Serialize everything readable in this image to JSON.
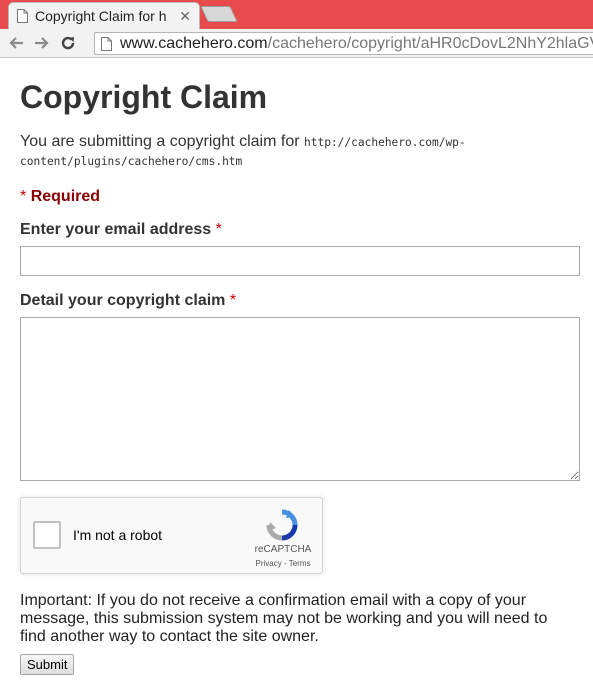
{
  "browser": {
    "tab_title": "Copyright Claim for h",
    "tab_close": "✕",
    "url_host": "www.cachehero.com",
    "url_path": "/cachehero/copyright/aHR0cDovL2NhY2hlaGV"
  },
  "page": {
    "title": "Copyright Claim",
    "intro_text": "You are submitting a copyright claim for ",
    "claim_url": "http://cachehero.com/wp-content/plugins/cachehero/cms.htm",
    "required_star": "*",
    "required_label": "Required",
    "email_label": "Enter your email address",
    "email_value": "",
    "claim_label": "Detail your copyright claim",
    "claim_value": "",
    "recaptcha": {
      "label": "I'm not a robot",
      "brand": "reCAPTCHA",
      "links": "Privacy - Terms"
    },
    "important_text": "Important: If you do not receive a confirmation email with a copy of your message, this submission system may not be working and you will need to find another way to contact the site owner.",
    "submit_label": "Submit"
  },
  "colors": {
    "tabstrip": "#e84b4b",
    "required_text": "#8b0000",
    "star": "#cc0000"
  },
  "icons": {
    "back": "arrow-left-icon",
    "forward": "arrow-right-icon",
    "reload": "reload-icon",
    "page": "page-icon",
    "recaptcha": "recaptcha-logo-icon"
  }
}
